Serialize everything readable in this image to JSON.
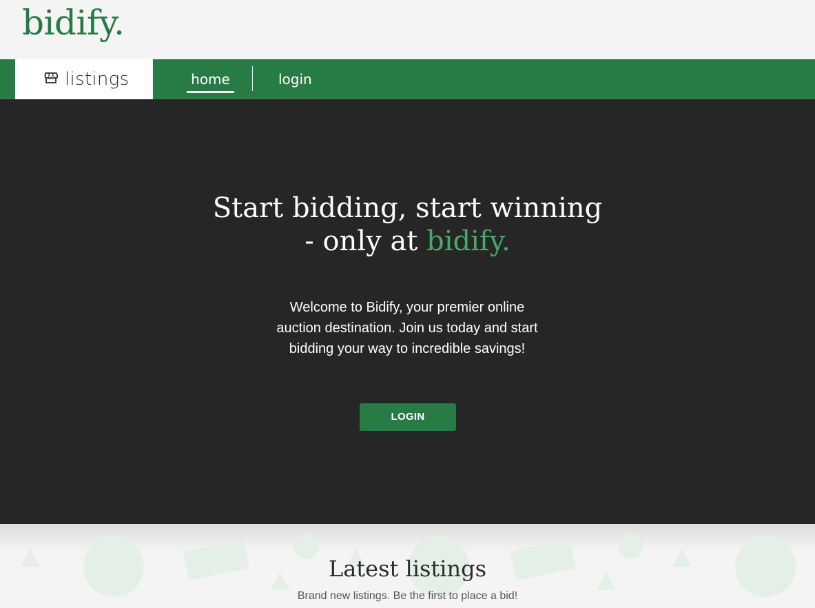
{
  "brand": {
    "logo_text": "bidify.",
    "accent_color": "#267a44"
  },
  "nav": {
    "listings_label": "listings",
    "listings_icon": "store-icon",
    "home_label": "home",
    "login_label": "login",
    "active": "home"
  },
  "hero": {
    "title_line1": "Start bidding, start winning",
    "title_line2_prefix": "- only at ",
    "title_line2_accent": "bidify.",
    "description": "Welcome to Bidify, your premier online auction destination. Join us today and start bidding your way to incredible savings!",
    "button_label": "LOGIN"
  },
  "latest": {
    "title": "Latest listings",
    "subtitle": "Brand new listings. Be the first to place a bid!"
  },
  "colors": {
    "primary_green": "#277b45",
    "hero_background": "#262626",
    "page_background": "#f4f4f4",
    "accent_text": "#48a868"
  }
}
